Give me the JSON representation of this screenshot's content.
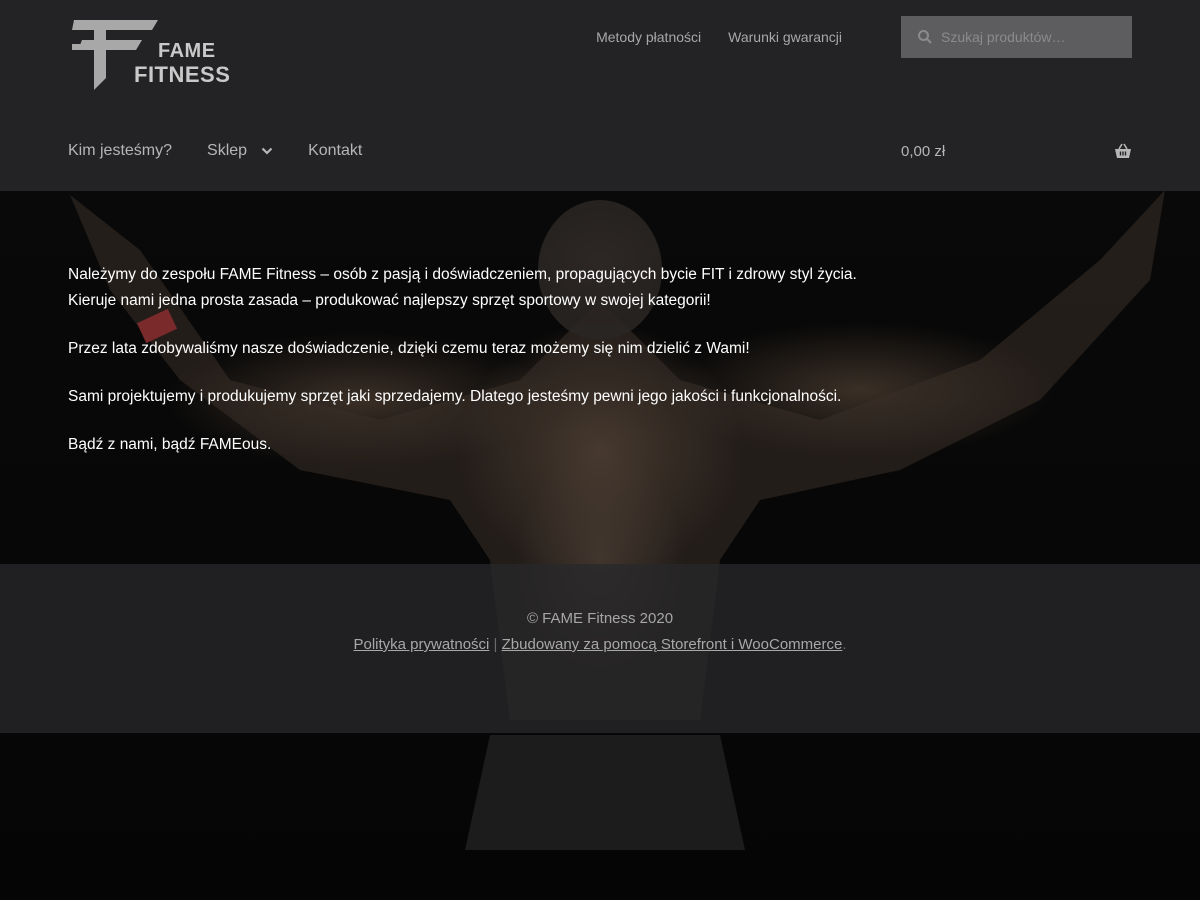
{
  "brand": {
    "name_line1": "FAME",
    "name_line2": "FITNESS"
  },
  "secondary_nav": [
    {
      "label": "Metody płatności"
    },
    {
      "label": "Warunki gwarancji"
    }
  ],
  "search": {
    "placeholder": "Szukaj produktów…",
    "value": ""
  },
  "primary_nav": [
    {
      "label": "Kim jesteśmy?"
    },
    {
      "label": "Sklep"
    },
    {
      "label": "Kontakt"
    }
  ],
  "cart": {
    "amount": "0,00 zł"
  },
  "content": {
    "line1": "Należymy do zespołu FAME Fitness – osób z pasją i doświadczeniem, propagujących bycie FIT i zdrowy styl życia.",
    "line2": "Kieruje nami jedna prosta zasada – produkować najlepszy sprzęt sportowy w swojej kategorii!",
    "para2": "Przez lata zdobywaliśmy nasze doświadczenie, dzięki czemu teraz możemy się nim dzielić z Wami!",
    "para3": "Sami projektujemy i produkujemy sprzęt jaki sprzedajemy. Dlatego jesteśmy pewni jego jakości i funkcjonalności.",
    "para4": "Bądź z nami, bądź FAMEous."
  },
  "footer": {
    "copyright": "© FAME Fitness 2020",
    "privacy_link": "Polityka prywatności",
    "separator": "|",
    "built_link": "Zbudowany za pomocą Storefront i WooCommerce",
    "trailing": "."
  },
  "colors": {
    "header_bg": "#232224",
    "nav_text": "#b6b6b6",
    "search_bg": "#5d5c5e",
    "footer_bg": "#28282a",
    "content_text": "#ffffff"
  },
  "icons": [
    "logo-mark-icon",
    "search-icon",
    "chevron-down-icon",
    "basket-icon"
  ]
}
